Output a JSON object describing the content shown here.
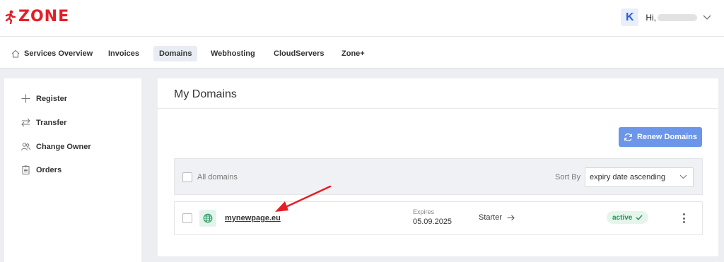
{
  "header": {
    "logo_text": "ZONE",
    "brand_color": "#e41e26",
    "user_initial": "K",
    "greeting": "Hi,"
  },
  "nav": {
    "items": [
      {
        "label": "Services Overview",
        "icon": "home-icon"
      },
      {
        "label": "Invoices"
      },
      {
        "label": "Domains",
        "active": true
      },
      {
        "label": "Webhosting"
      },
      {
        "label": "CloudServers"
      },
      {
        "label": "Zone+"
      }
    ]
  },
  "sidebar": {
    "items": [
      {
        "label": "Register",
        "icon": "plus-icon"
      },
      {
        "label": "Transfer",
        "icon": "transfer-arrows-icon"
      },
      {
        "label": "Change Owner",
        "icon": "users-icon"
      },
      {
        "label": "Orders",
        "icon": "clipboard-icon"
      }
    ]
  },
  "main": {
    "title": "My Domains",
    "renew_button": "Renew Domains",
    "accent_color": "#6b96e9",
    "filter": {
      "all_label": "All domains",
      "sort_label": "Sort By",
      "sort_value": "expiry date ascending"
    },
    "domains": [
      {
        "name": "mynewpage.eu",
        "expires_label": "Expires",
        "expires_date": "05.09.2025",
        "plan": "Starter",
        "status": "active",
        "status_color": "#17995a"
      }
    ]
  }
}
